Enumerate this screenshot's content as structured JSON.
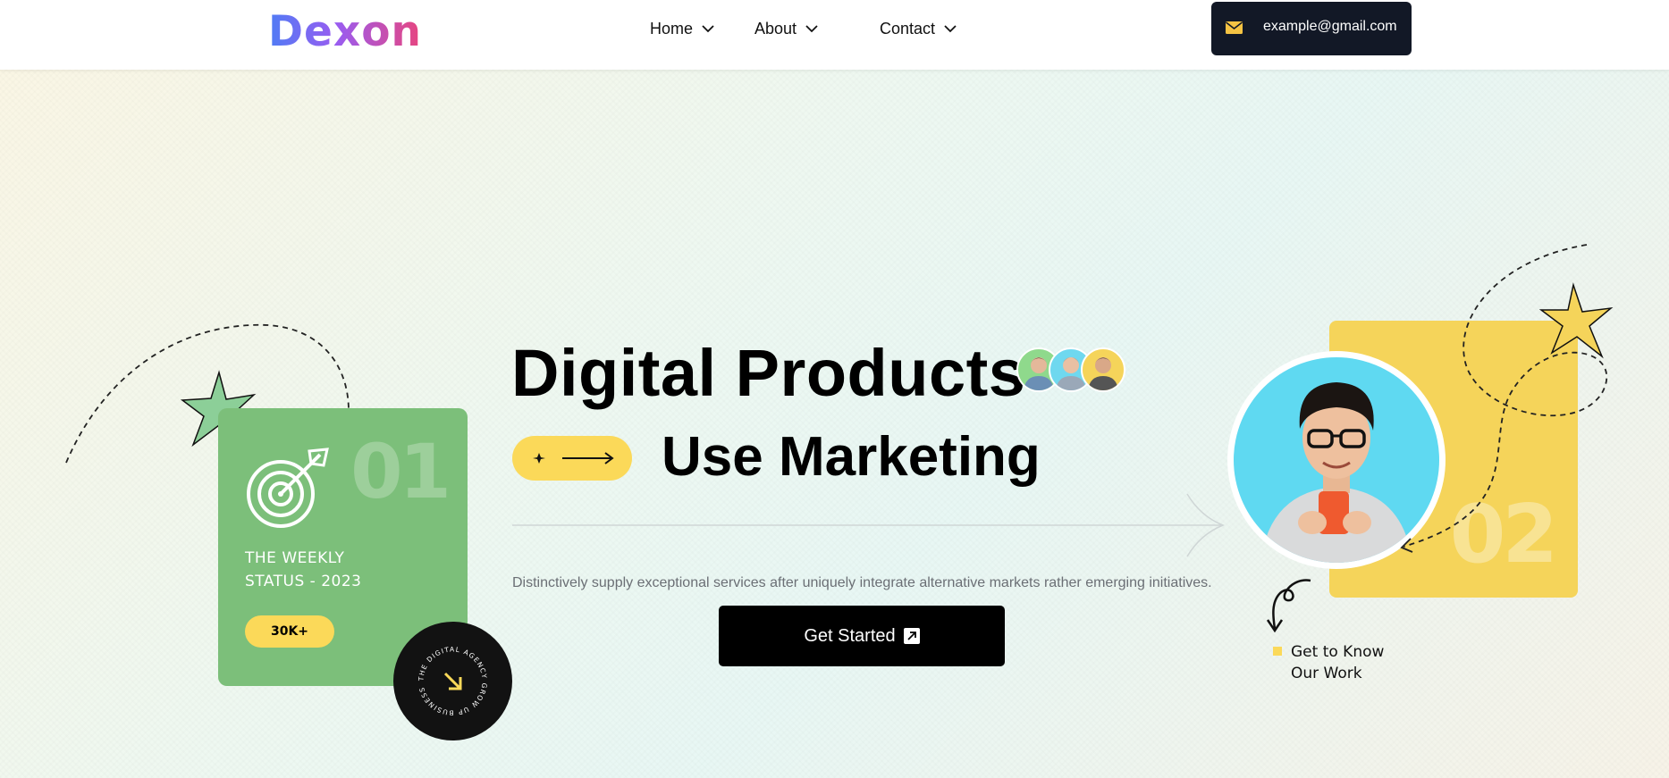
{
  "header": {
    "logo": "Dexon",
    "nav": [
      {
        "label": "Home"
      },
      {
        "label": "About"
      },
      {
        "label": "Contact"
      }
    ],
    "email": "example@gmail.com"
  },
  "hero": {
    "headline_line1": "Digital Products",
    "headline_line2": "Use Marketing",
    "description": "Distinctively supply exceptional services after uniquely integrate alternative markets rather emerging initiatives.",
    "cta_label": "Get Started"
  },
  "card_left": {
    "number": "01",
    "title_line1": "THE WEEKLY",
    "title_line2": "STATUS - 2023",
    "badge": "30K+"
  },
  "circle_badge": {
    "ring_text": "THE DIGITAL AGENCY GROW UP BUSINESS"
  },
  "card_right": {
    "number": "02",
    "link_line1": "Get to Know",
    "link_line2": "Our Work"
  },
  "colors": {
    "accent_yellow": "#fbd959",
    "card_green": "#7cbf7a",
    "dark": "#121826"
  }
}
